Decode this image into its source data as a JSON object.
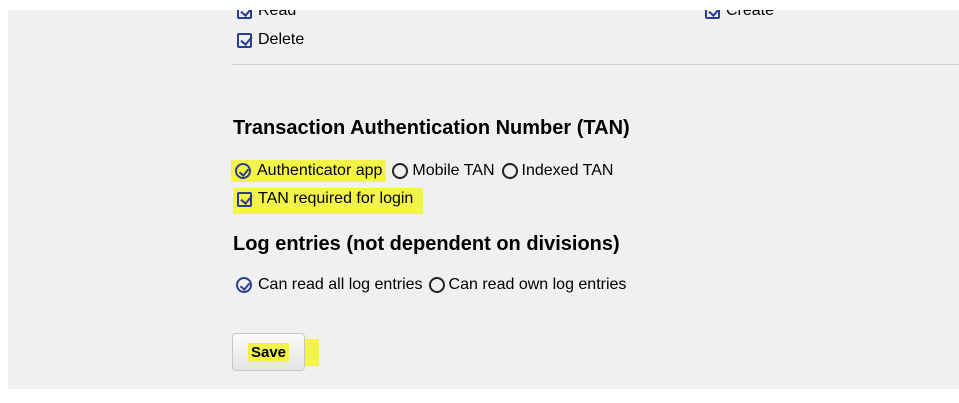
{
  "permissions": {
    "read_label": "Read",
    "create_label": "Create",
    "delete_label": "Delete"
  },
  "tan": {
    "heading": "Transaction Authentication Number (TAN)",
    "options": [
      "Authenticator app",
      "Mobile TAN",
      "Indexed TAN"
    ],
    "selected": "Authenticator app",
    "login_required_label": "TAN required for login"
  },
  "log": {
    "heading": "Log entries (not dependent on divisions)",
    "options": [
      "Can read all log entries",
      "Can read own log entries"
    ],
    "selected": "Can read all log entries"
  },
  "actions": {
    "save_label": "Save"
  },
  "colors": {
    "highlight": "#f3f44a",
    "check_accent": "#2a3d8f",
    "panel_bg": "#f0f0f0"
  }
}
